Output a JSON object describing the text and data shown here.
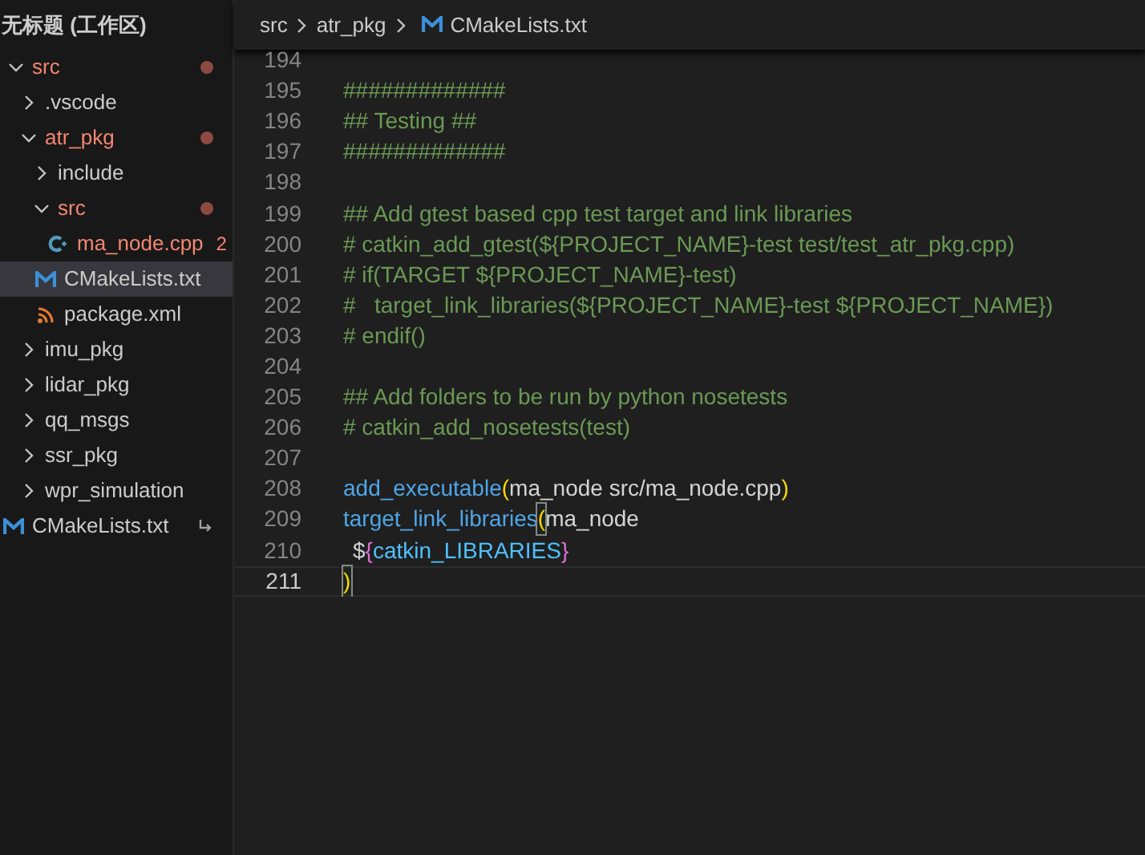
{
  "explorer": {
    "title": "无标题 (工作区)",
    "tree": [
      {
        "name": "src",
        "kind": "folder",
        "expanded": true,
        "modified": true,
        "selected": false,
        "children": [
          {
            "name": ".vscode",
            "kind": "folder",
            "expanded": false,
            "modified": false,
            "selected": false
          },
          {
            "name": "atr_pkg",
            "kind": "folder",
            "expanded": true,
            "modified": true,
            "selected": false,
            "children": [
              {
                "name": "include",
                "kind": "folder",
                "expanded": false,
                "modified": false,
                "selected": false
              },
              {
                "name": "src",
                "kind": "folder",
                "expanded": true,
                "modified": true,
                "selected": false,
                "children": [
                  {
                    "name": "ma_node.cpp",
                    "kind": "cpp",
                    "modified": true,
                    "problems": "2",
                    "selected": false
                  }
                ]
              },
              {
                "name": "CMakeLists.txt",
                "kind": "cmake",
                "modified": false,
                "selected": true
              },
              {
                "name": "package.xml",
                "kind": "xml",
                "modified": false,
                "selected": false
              }
            ]
          },
          {
            "name": "imu_pkg",
            "kind": "folder",
            "expanded": false,
            "modified": false,
            "selected": false
          },
          {
            "name": "lidar_pkg",
            "kind": "folder",
            "expanded": false,
            "modified": false,
            "selected": false
          },
          {
            "name": "qq_msgs",
            "kind": "folder",
            "expanded": false,
            "modified": false,
            "selected": false
          },
          {
            "name": "ssr_pkg",
            "kind": "folder",
            "expanded": false,
            "modified": false,
            "selected": false
          },
          {
            "name": "wpr_simulation",
            "kind": "folder",
            "expanded": false,
            "modified": false,
            "selected": false
          }
        ]
      },
      {
        "name": "CMakeLists.txt",
        "kind": "cmake",
        "modified": false,
        "selected": false,
        "symlink": true
      }
    ]
  },
  "breadcrumb": [
    "src",
    "atr_pkg",
    "CMakeLists.txt"
  ],
  "editor": {
    "lines": [
      {
        "number": "194",
        "current": false
      },
      {
        "number": "195",
        "current": false,
        "tokens": [
          {
            "kind": "comment",
            "text": "#############"
          }
        ]
      },
      {
        "number": "196",
        "current": false,
        "tokens": [
          {
            "kind": "comment",
            "text": "## Testing ##"
          }
        ]
      },
      {
        "number": "197",
        "current": false,
        "tokens": [
          {
            "kind": "comment",
            "text": "#############"
          }
        ]
      },
      {
        "number": "198",
        "current": false
      },
      {
        "number": "199",
        "current": false,
        "tokens": [
          {
            "kind": "comment",
            "text": "## Add gtest based cpp test target and link libraries"
          }
        ]
      },
      {
        "number": "200",
        "current": false,
        "tokens": [
          {
            "kind": "comment",
            "text": "# catkin_add_gtest(${PROJECT_NAME}-test test/test_atr_pkg.cpp)"
          }
        ]
      },
      {
        "number": "201",
        "current": false,
        "tokens": [
          {
            "kind": "comment",
            "text": "# if(TARGET ${PROJECT_NAME}-test)"
          }
        ]
      },
      {
        "number": "202",
        "current": false,
        "tokens": [
          {
            "kind": "comment",
            "text": "#   target_link_libraries(${PROJECT_NAME}-test ${PROJECT_NAME})"
          }
        ]
      },
      {
        "number": "203",
        "current": false,
        "tokens": [
          {
            "kind": "comment",
            "text": "# endif()"
          }
        ]
      },
      {
        "number": "204",
        "current": false
      },
      {
        "number": "205",
        "current": false,
        "tokens": [
          {
            "kind": "comment",
            "text": "## Add folders to be run by python nosetests"
          }
        ]
      },
      {
        "number": "206",
        "current": false,
        "tokens": [
          {
            "kind": "comment",
            "text": "# catkin_add_nosetests(test)"
          }
        ]
      },
      {
        "number": "207",
        "current": false
      },
      {
        "number": "208",
        "current": false,
        "tokens": [
          {
            "kind": "function",
            "text": "add_executable"
          },
          {
            "kind": "paren",
            "text": "(",
            "matched": false
          },
          {
            "kind": "plain",
            "text": "ma_node src/ma_node.cpp"
          },
          {
            "kind": "paren",
            "text": ")",
            "matched": false
          }
        ]
      },
      {
        "number": "209",
        "current": false,
        "tokens": [
          {
            "kind": "function",
            "text": "target_link_libraries"
          },
          {
            "kind": "paren",
            "text": "(",
            "matched": true
          },
          {
            "kind": "plain",
            "text": "ma_node"
          }
        ]
      },
      {
        "number": "210",
        "current": false,
        "indented": true,
        "tokens": [
          {
            "kind": "plain",
            "text": "$"
          },
          {
            "kind": "brace",
            "text": "{"
          },
          {
            "kind": "variable",
            "text": "catkin_LIBRARIES"
          },
          {
            "kind": "brace",
            "text": "}"
          }
        ]
      },
      {
        "number": "211",
        "current": true,
        "tokens": [
          {
            "kind": "paren",
            "text": ")",
            "matched": true
          }
        ]
      }
    ]
  }
}
